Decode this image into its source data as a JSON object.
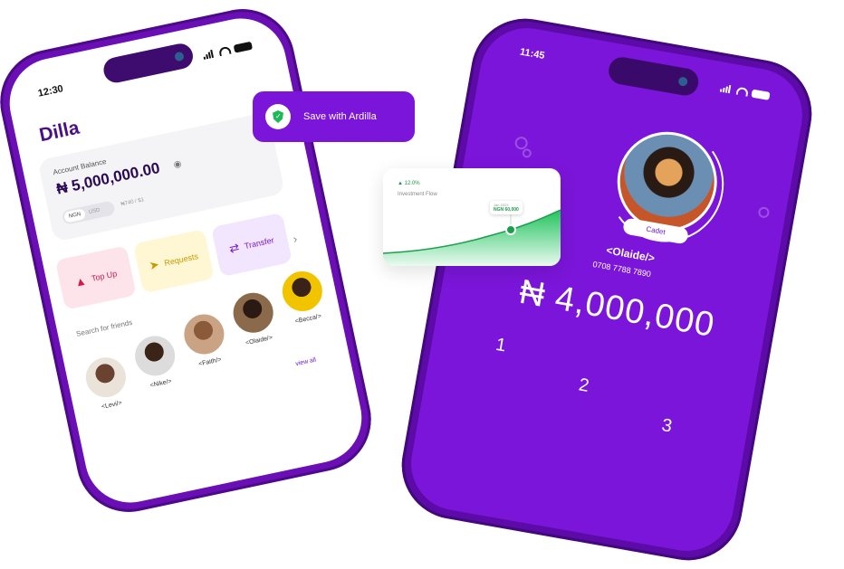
{
  "save_card": {
    "label": "Save with Ardilla"
  },
  "invest_card": {
    "percent": "12.0%",
    "label": "Investment Flow",
    "tooltip_date": "Jan 2023",
    "tooltip_value": "NGN 60,000"
  },
  "left_phone": {
    "time": "12:30",
    "app_title": "Dilla",
    "account_label": "Account Balance",
    "balance": "₦ 5,000,000.00",
    "currency_active": "NGN",
    "currency_other": "USD",
    "rate": "₦740 / $1",
    "actions": [
      {
        "label": "Top Up"
      },
      {
        "label": "Requests"
      },
      {
        "label": "Transfer"
      }
    ],
    "search_label": "Search for friends",
    "friends": [
      "<Levi/>",
      "<Nike/>",
      "<Faith/>",
      "<Olaide/>",
      "<Becca/>"
    ],
    "view_all": "view all"
  },
  "right_phone": {
    "time": "11:45",
    "badge": "Cadet",
    "handle": "<Olaide/>",
    "phone_number": "0708 7788 7890",
    "amount": "₦ 4,000,000",
    "keys": [
      "1",
      "2",
      "3"
    ]
  }
}
